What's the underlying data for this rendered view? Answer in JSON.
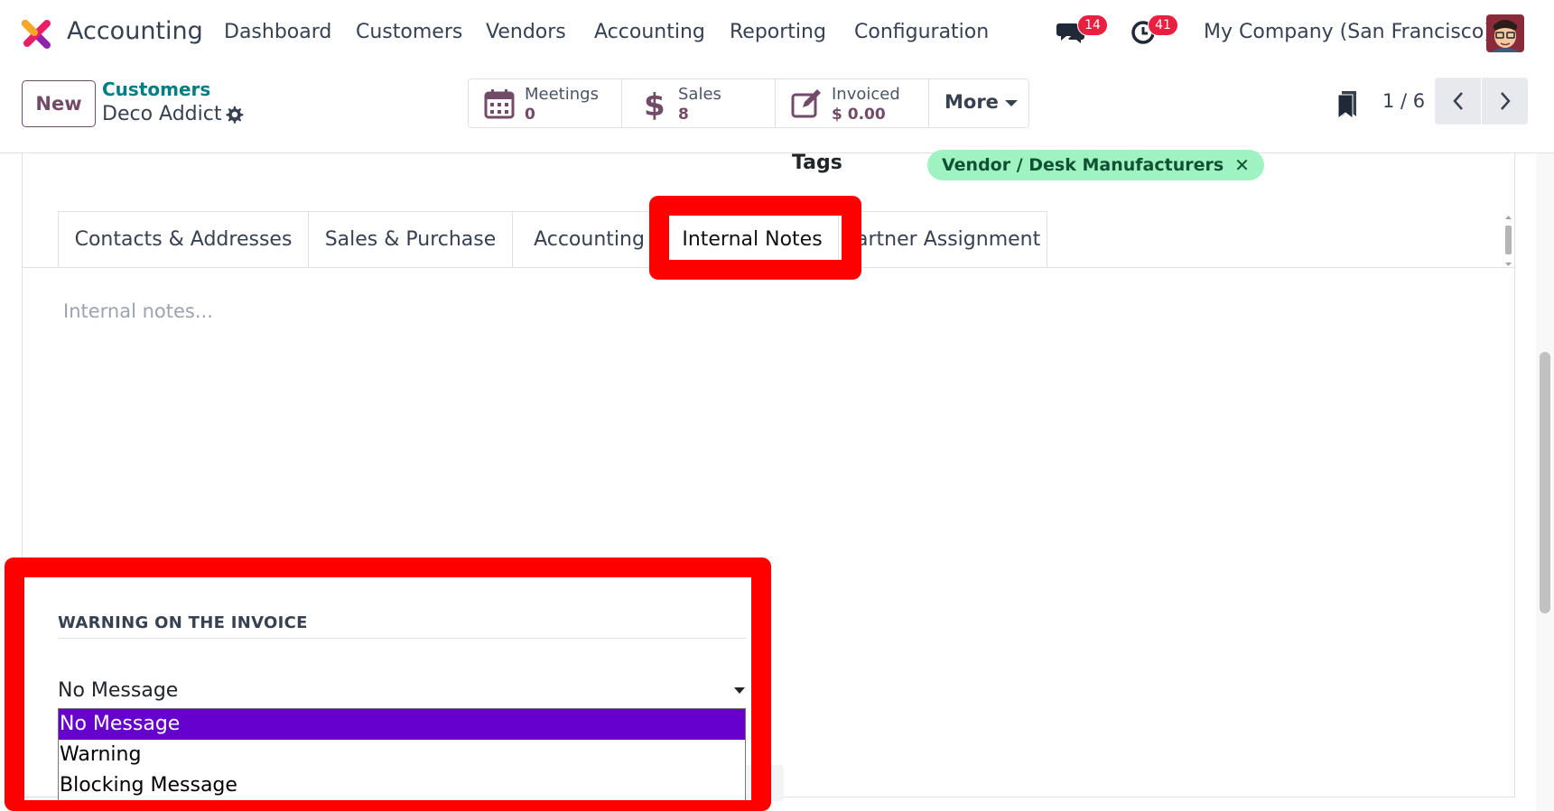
{
  "navbar": {
    "app_name": "Accounting",
    "menu": [
      "Dashboard",
      "Customers",
      "Vendors",
      "Accounting",
      "Reporting",
      "Configuration"
    ],
    "messages_count": "14",
    "activities_count": "41",
    "company": "My Company (San Francisco)",
    "logo_colors": [
      "#f9a825",
      "#e91e63",
      "#8e24aa"
    ]
  },
  "control": {
    "new_label": "New",
    "breadcrumb_parent": "Customers",
    "breadcrumb_current": "Deco Addict",
    "stats": [
      {
        "icon": "calendar-icon",
        "label": "Meetings",
        "value": "0"
      },
      {
        "icon": "dollar-icon",
        "label": "Sales",
        "value": "8"
      },
      {
        "icon": "edit-icon",
        "label": "Invoiced",
        "value": "$ 0.00"
      }
    ],
    "more_label": "More",
    "pager": "1 / 6"
  },
  "form": {
    "tags_label": "Tags",
    "tag": "Vendor / Desk Manufacturers",
    "tabs": [
      "Contacts & Addresses",
      "Sales & Purchase",
      "Accounting",
      "Internal Notes",
      "Partner Assignment"
    ],
    "active_tab": "Internal Notes",
    "notes_placeholder": "Internal notes...",
    "warning_title": "WARNING ON THE INVOICE",
    "warning_value": "No Message",
    "warning_options": [
      "No Message",
      "Warning",
      "Blocking Message"
    ]
  },
  "colors": {
    "primary": "#714b67",
    "teal": "#017e84",
    "tag_bg": "#9ff2c2",
    "highlight": "#ff0000",
    "selected_option": "#6600cc"
  }
}
